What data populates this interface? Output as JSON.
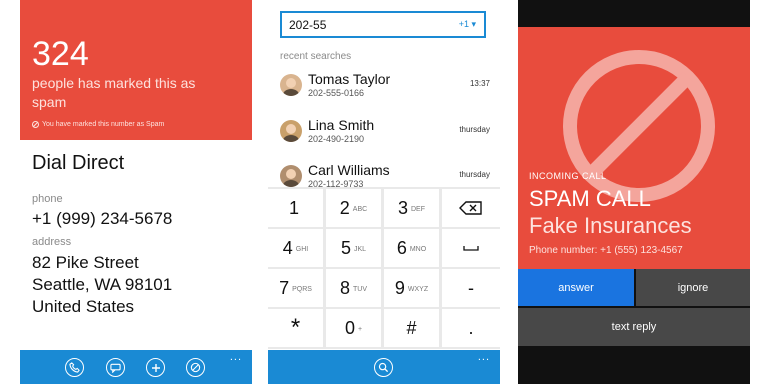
{
  "contact_screen": {
    "spam_count": "324",
    "spam_text": "people has marked this as spam",
    "marked_note": "You have marked this number as Spam",
    "name": "Dial Direct",
    "phone_label": "phone",
    "phone_value": "+1 (999) 234-5678",
    "address_label": "address",
    "address_line1": "82 Pike Street",
    "address_line2": "Seattle, WA 98101",
    "address_line3": "United States",
    "appbar_icons": [
      "phone-icon",
      "message-icon",
      "add-icon",
      "block-icon"
    ],
    "more": "..."
  },
  "dialer_screen": {
    "search_value": "202-55",
    "country_code": "+1",
    "recent_label": "recent searches",
    "recents": [
      {
        "name": "Tomas Taylor",
        "number": "202-555-0166",
        "time": "13:37"
      },
      {
        "name": "Lina Smith",
        "number": "202-490-2190",
        "time": "thursday"
      },
      {
        "name": "Carl Williams",
        "number": "202-112-9733",
        "time": "thursday"
      }
    ],
    "keys": [
      {
        "digit": "1",
        "letters": ""
      },
      {
        "digit": "2",
        "letters": "ABC"
      },
      {
        "digit": "3",
        "letters": "DEF"
      },
      {
        "digit": "4",
        "letters": "GHI"
      },
      {
        "digit": "5",
        "letters": "JKL"
      },
      {
        "digit": "6",
        "letters": "MNO"
      },
      {
        "digit": "7",
        "letters": "PQRS"
      },
      {
        "digit": "8",
        "letters": "TUV"
      },
      {
        "digit": "9",
        "letters": "WXYZ"
      },
      {
        "digit": "*",
        "letters": ""
      },
      {
        "digit": "0",
        "letters": "+"
      },
      {
        "digit": "#",
        "letters": ""
      }
    ],
    "side_keys": [
      "backspace",
      "space",
      "-",
      "."
    ],
    "more": "..."
  },
  "call_screen": {
    "incoming_label": "INCOMING CALL",
    "title": "SPAM CALL",
    "caller": "Fake Insurances",
    "phone": "Phone number: +1 (555) 123-4567",
    "answer": "answer",
    "ignore": "ignore",
    "text_reply": "text reply"
  },
  "colors": {
    "red": "#e84c3d",
    "blue": "#1a8ad4",
    "answer_blue": "#1a74e0",
    "gray": "#484848"
  }
}
